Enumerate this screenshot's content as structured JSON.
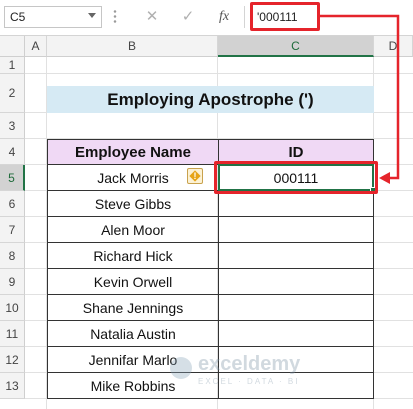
{
  "formula_bar": {
    "name_box": "C5",
    "cancel_glyph": "✕",
    "enter_glyph": "✓",
    "fx_label": "fx",
    "formula": "'000111"
  },
  "columns": [
    "A",
    "B",
    "C",
    "D"
  ],
  "rows": [
    "1",
    "2",
    "3",
    "4",
    "5",
    "6",
    "7",
    "8",
    "9",
    "10",
    "11",
    "12",
    "13"
  ],
  "sheet": {
    "title": "Employing Apostrophe (')",
    "headers": {
      "name": "Employee Name",
      "id": "ID"
    },
    "employees": [
      {
        "name": "Jack Morris",
        "id": "000111"
      },
      {
        "name": "Steve Gibbs",
        "id": ""
      },
      {
        "name": "Alen Moor",
        "id": ""
      },
      {
        "name": "Richard Hick",
        "id": ""
      },
      {
        "name": "Kevin Orwell",
        "id": ""
      },
      {
        "name": "Shane Jennings",
        "id": ""
      },
      {
        "name": "Natalia Austin",
        "id": ""
      },
      {
        "name": "Jennifar Marlo",
        "id": ""
      },
      {
        "name": "Mike Robbins",
        "id": ""
      }
    ]
  },
  "selection": {
    "active_cell": "C5",
    "selected_column": "C",
    "selected_row": "5"
  },
  "warning_badge": {
    "icon": "error-warning-icon",
    "glyph": "!"
  },
  "watermark": {
    "name": "exceldemy",
    "tagline": "EXCEL · DATA · BI",
    "icon": "exceldemy-logo"
  },
  "colors": {
    "title_fill": "#d6eaf4",
    "header_fill": "#f0d9f5",
    "highlight": "#e5242b",
    "selection": "#217346"
  }
}
